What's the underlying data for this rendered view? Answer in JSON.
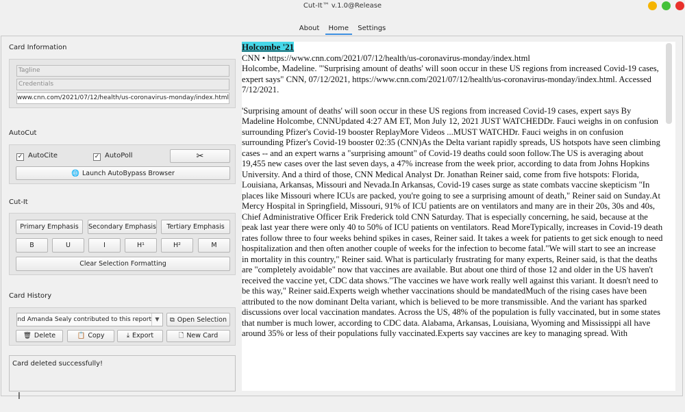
{
  "window": {
    "title": "Cut-It™ v.1.0@Release"
  },
  "nav": {
    "tabs": [
      "About",
      "Home",
      "Settings"
    ],
    "active": "Home"
  },
  "card_information": {
    "section_label": "Card Information",
    "tagline_placeholder": "Tagline",
    "credentials_placeholder": "Credentials",
    "url_value": "www.cnn.com/2021/07/12/health/us-coronavirus-monday/index.html"
  },
  "autocut": {
    "section_label": "AutoCut",
    "autocite_label": "AutoCite",
    "autopoll_label": "AutoPoll",
    "autocite_checked": true,
    "autopoll_checked": true,
    "cut_icon": "scissors-icon",
    "launch_button": "Launch AutoBypass Browser",
    "launch_icon": "globe-icon"
  },
  "cutit": {
    "section_label": "Cut-It",
    "primary": "Primary Emphasis",
    "secondary": "Secondary Emphasis",
    "tertiary": "Tertiary Emphasis",
    "format_buttons": [
      "B",
      "U",
      "I",
      "H¹",
      "H²",
      "M"
    ],
    "clear": "Clear Selection Formatting"
  },
  "history": {
    "section_label": "Card History",
    "combo_value": "Charles Jones and Amanda Sealy contributed to this report.",
    "open_selection": "Open Selection",
    "delete": "Delete",
    "copy": "Copy",
    "export": "Export",
    "new_card": "New Card"
  },
  "status": {
    "message": "Card deleted successfully!"
  },
  "document": {
    "tag": "Holcombe '21",
    "source_line": "CNN • https://www.cnn.com/2021/07/12/health/us-coronavirus-monday/index.html",
    "citation": "Holcombe, Madeline. \"'Surprising amount of deaths' will soon occur in these US regions from increased Covid-19 cases, expert says\" CNN, 07/12/2021, https://www.cnn.com/2021/07/12/health/us-coronavirus-monday/index.html. Accessed 7/12/2021.",
    "body": "'Surprising amount of deaths' will soon occur in these US regions from increased Covid-19 cases, expert says By Madeline Holcombe, CNNUpdated 4:27 AM ET, Mon July 12, 2021 JUST WATCHEDDr. Fauci weighs in on confusion surrounding Pfizer's Covid-19 booster ReplayMore Videos ...MUST WATCHDr. Fauci weighs in on confusion surrounding Pfizer's Covid-19 booster 02:35 (CNN)As the Delta variant rapidly spreads, US hotspots have seen climbing cases -- and an expert warns a \"surprising amount\" of Covid-19 deaths could soon follow.The US is averaging about 19,455 new cases over the last seven days, a 47% increase from the week prior, according to data from Johns Hopkins University. And a third of those, CNN Medical Analyst Dr. Jonathan Reiner said, come from five hotspots: Florida, Louisiana, Arkansas, Missouri and Nevada.In Arkansas, Covid-19 cases surge as state combats vaccine skepticism \"In places like Missouri where ICUs are packed, you're going to see a surprising amount of death,\" Reiner said on Sunday.At Mercy Hospital in Springfield, Missouri, 91% of ICU patients are on ventilators and many are in their 20s, 30s and 40s, Chief Administrative Officer Erik Frederick told CNN Saturday. That is especially concerning, he said, because at the peak last year there were only 40 to 50% of ICU patients on ventilators. Read MoreTypically, increases in Covid-19 death rates follow three to four weeks behind spikes in cases, Reiner said. It takes a week for patients to get sick enough to need hospitalization and then often another couple of weeks for the infection to become fatal.\"We will start to see an increase in mortality in this country,\" Reiner said. What is particularly frustrating for many experts, Reiner said, is that the deaths are \"completely avoidable\" now that vaccines are available. But about one third of those 12 and older in the US haven't received the vaccine yet, CDC data shows.\"The vaccines we have work really well against this variant. It doesn't need to be this way,\" Reiner said.Experts weigh whether vaccinations should be mandatedMuch of the rising cases have been attributed to the now dominant Delta variant, which is believed to be more transmissible. And the variant has sparked discussions over local vaccination mandates. Across the US, 48% of the population is fully vaccinated, but in some states that number is much lower, according to CDC data. Alabama, Arkansas, Louisiana, Wyoming and Mississippi all have around 35% or less of their populations fully vaccinated.Experts say vaccines are key to managing spread. With"
  }
}
